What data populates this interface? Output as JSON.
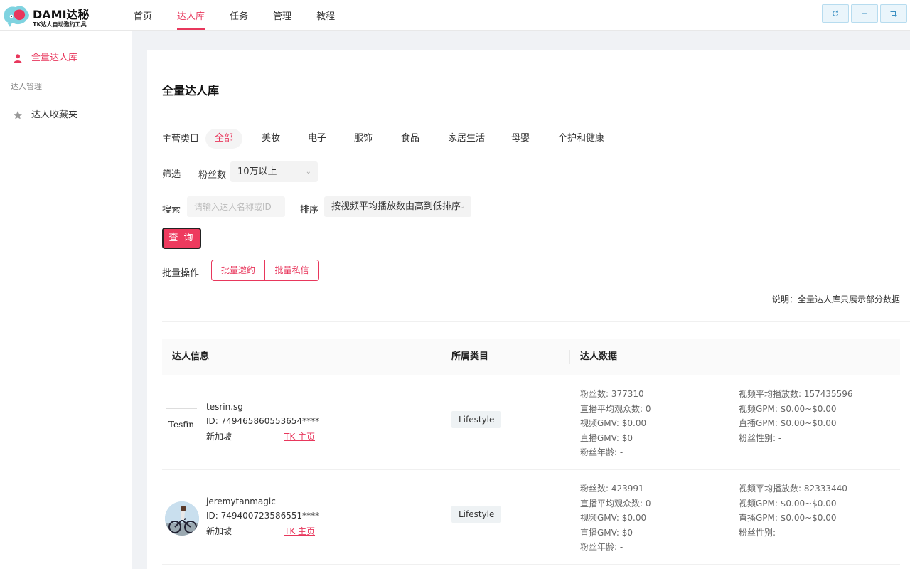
{
  "app": {
    "logo_title": "DAMI达秘",
    "logo_subtitle": "TK达人自动邀约工具"
  },
  "nav": [
    "首页",
    "达人库",
    "任务",
    "管理",
    "教程"
  ],
  "nav_active": "达人库",
  "window_controls": [
    "refresh-icon",
    "minimize-icon",
    "maximize-icon"
  ],
  "sidebar": {
    "items": [
      {
        "label": "全量达人库",
        "icon": "person-icon",
        "active": true
      },
      {
        "label": "达人收藏夹",
        "icon": "star-icon",
        "active": false
      }
    ],
    "group_label": "达人管理"
  },
  "page": {
    "title": "全量达人库",
    "category_label": "主营类目",
    "categories": [
      "全部",
      "美妆",
      "电子",
      "服饰",
      "食品",
      "家居生活",
      "母婴",
      "个护和健康"
    ],
    "category_selected": "全部",
    "filter_label": "筛选",
    "followers_label": "粉丝数",
    "followers_value": "10万以上",
    "search_label": "搜索",
    "search_placeholder": "请输入达人名称或ID",
    "sort_label": "排序",
    "sort_value": "按视频平均播放数由高到低排序",
    "query_button": "查 询",
    "bulk_label": "批量操作",
    "bulk_invite": "批量邀约",
    "bulk_message": "批量私信",
    "note": "说明：全量达人库只展示部分数据"
  },
  "table": {
    "headers": [
      "达人信息",
      "所属类目",
      "达人数据"
    ],
    "rows": [
      {
        "name": "tesrin.sg",
        "id": "ID:  749465860553654****",
        "region": "新加坡",
        "link": "TK 主页",
        "avatar_text": "Tesfin",
        "category": "Lifestyle",
        "stats_left": [
          "粉丝数: 377310",
          "直播平均观众数: 0",
          "视频GMV: $0.00",
          "直播GMV: $0",
          "粉丝年龄: -"
        ],
        "stats_right": [
          "视频平均播放数: 157435596",
          "视频GPM: $0.00~$0.00",
          "直播GPM: $0.00~$0.00",
          "粉丝性别: -"
        ]
      },
      {
        "name": "jeremytanmagic",
        "id": "ID:  749400723586551****",
        "region": "新加坡",
        "link": "TK 主页",
        "avatar_text": "",
        "category": "Lifestyle",
        "stats_left": [
          "粉丝数: 423991",
          "直播平均观众数: 0",
          "视频GMV: $0.00",
          "直播GMV: $0",
          "粉丝年龄: -"
        ],
        "stats_right": [
          "视频平均播放数: 82333440",
          "视频GPM: $0.00~$0.00",
          "直播GPM: $0.00~$0.00",
          "粉丝性别: -"
        ]
      }
    ]
  },
  "colors": {
    "accent": "#e8375c",
    "query_bg": "#ee3a5e"
  }
}
